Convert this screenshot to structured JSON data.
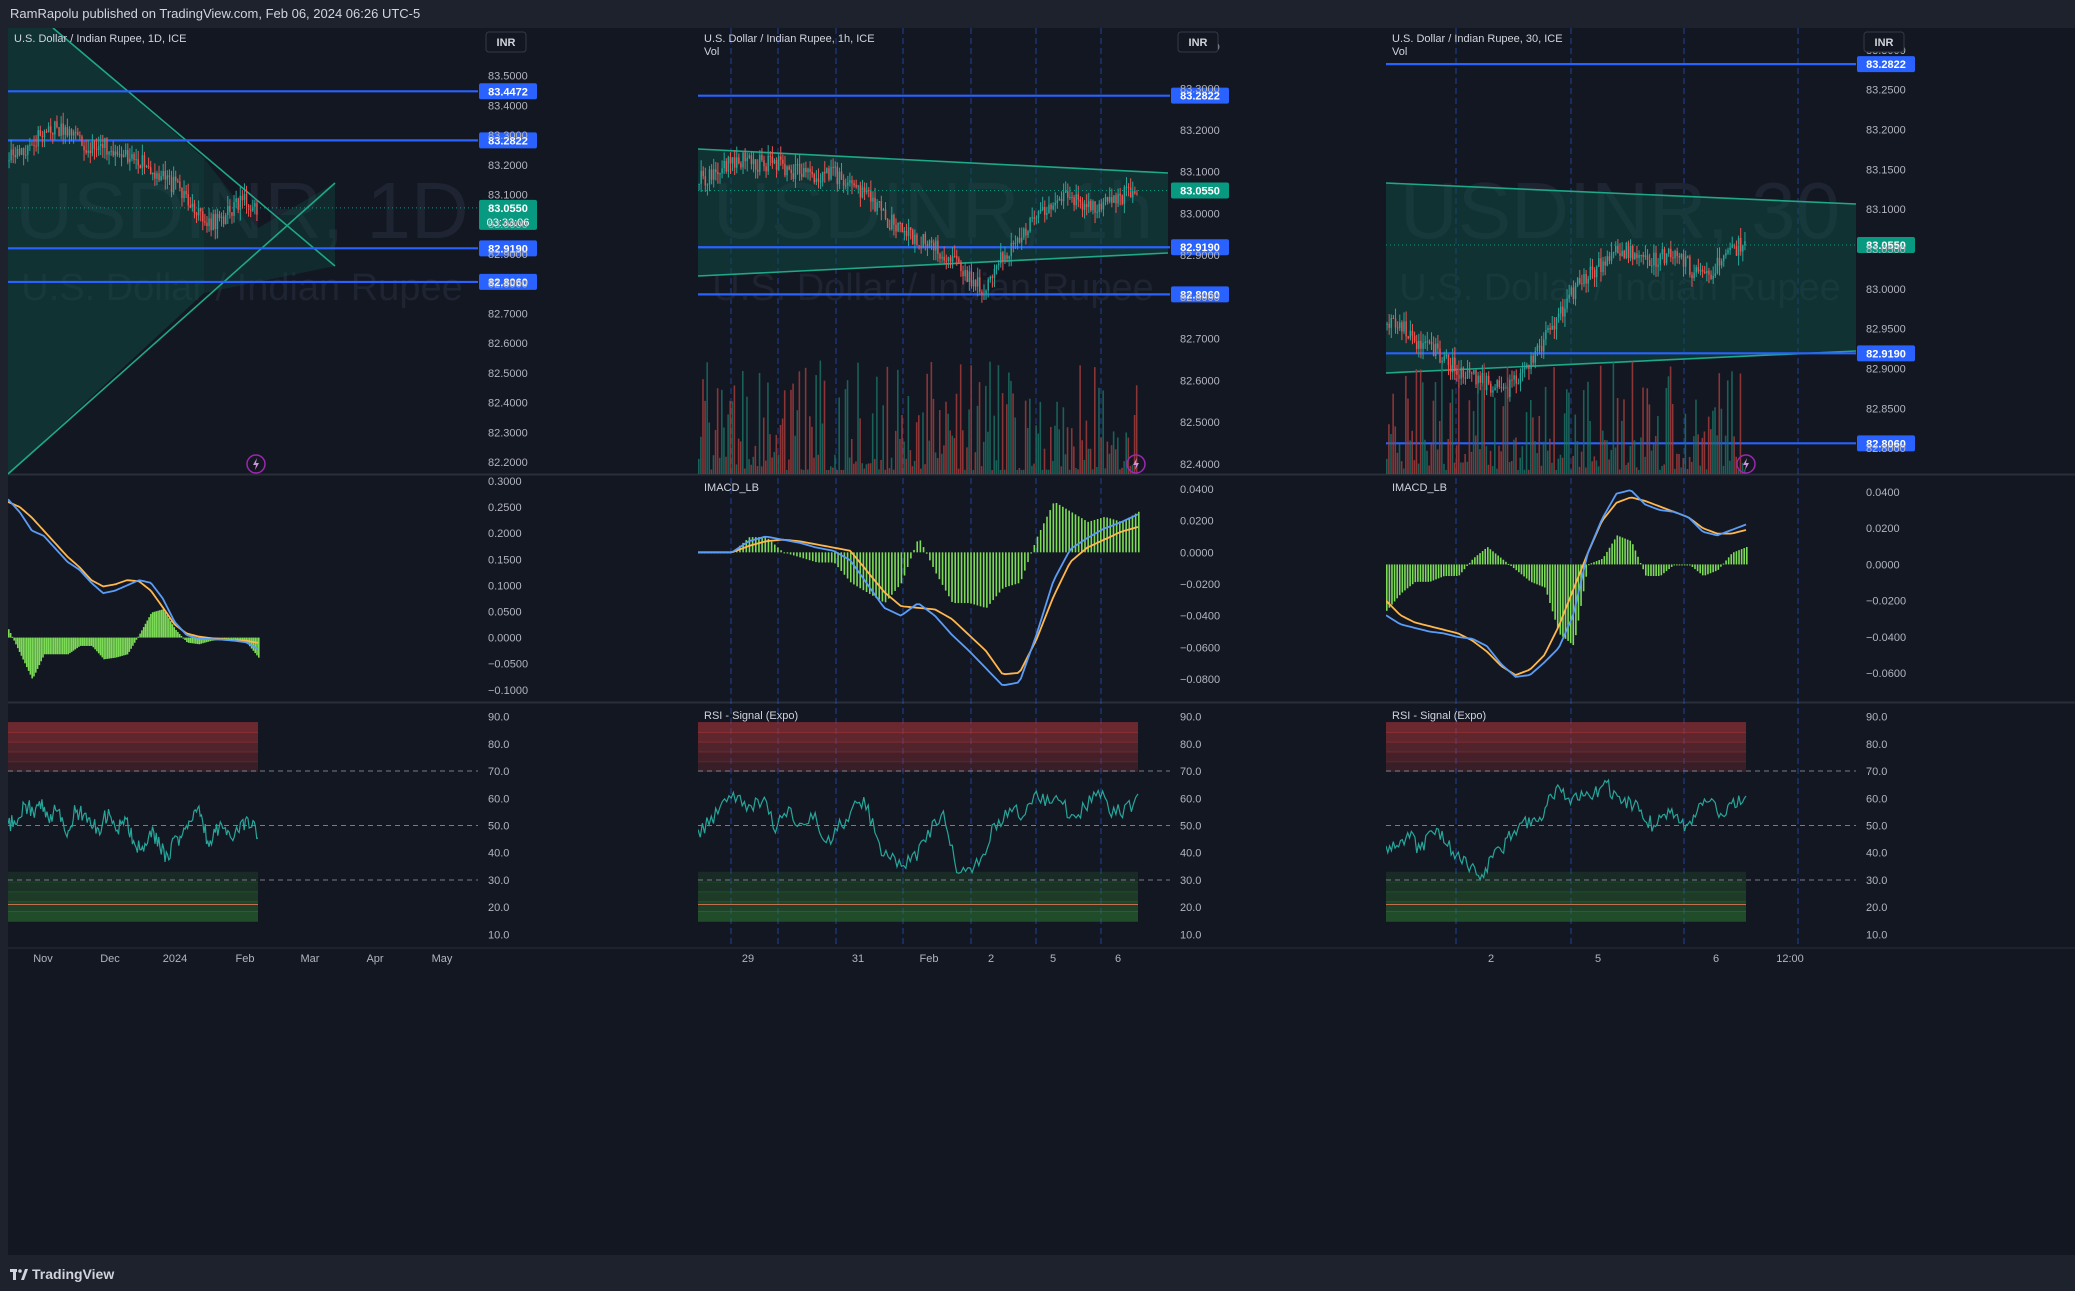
{
  "header": {
    "published_text": "RamRapolu published on TradingView.com, Feb 06, 2024 06:26 UTC-5"
  },
  "footer": {
    "brand": "TradingView"
  },
  "colors": {
    "background": "#131722",
    "grid": "#1e2230",
    "level_line": "#2962ff",
    "label_blue": "#2962ff",
    "last_price": "#089981",
    "triangle": "#1ea888",
    "macd": "#5b9cf6",
    "signal": "#ffb74d",
    "hist_up": "#7ddc57",
    "rsi": "#26a69a",
    "ob_band": "#b5373a",
    "os_band": "#2e7d32"
  },
  "icons": [
    "lightning-icon",
    "tradingview-logo-icon"
  ],
  "chart_data": [
    {
      "type": "candlestick",
      "title": "U.S. Dollar / Indian Rupee, 1D, ICE",
      "watermark_symbol": "USDINR, 1D",
      "watermark_name": "U.S. Dollar / Indian Rupee",
      "currency": "INR",
      "yticks": [
        "83.5000",
        "83.4000",
        "83.3000",
        "83.2000",
        "83.1000",
        "83.0000",
        "82.9000",
        "82.8000",
        "82.7000",
        "82.6000",
        "82.5000",
        "82.4000",
        "82.3000",
        "82.2000"
      ],
      "ylim": [
        82.18,
        83.64
      ],
      "xticks": [
        "Nov",
        "Dec",
        "2024",
        "Feb",
        "Mar",
        "Apr",
        "May"
      ],
      "levels": [
        83.4472,
        83.2822,
        82.919,
        82.806
      ],
      "level_labels": [
        "83.4472",
        "83.2822",
        "82.9190",
        "82.8060"
      ],
      "last_price": "83.0550",
      "countdown": "03:33:06",
      "approx_range": {
        "start_date": "2023-10-20",
        "end_date": "2024-02-06",
        "high": 83.47,
        "low": 82.79,
        "close": 83.055
      },
      "macd": {
        "title": "",
        "yticks": [
          "0.3000",
          "0.2500",
          "0.2000",
          "0.1500",
          "0.1000",
          "0.0500",
          "0.0000",
          "−0.0500",
          "−0.1000"
        ],
        "ylim": [
          -0.11,
          0.3
        ],
        "macd_values": [
          0.265,
          0.24,
          0.205,
          0.195,
          0.17,
          0.145,
          0.13,
          0.105,
          0.085,
          0.09,
          0.1,
          0.11,
          0.105,
          0.075,
          0.03,
          0.005,
          -0.002,
          -0.003,
          -0.004,
          -0.006,
          -0.009,
          -0.022
        ],
        "signal_values": [
          0.26,
          0.25,
          0.23,
          0.205,
          0.18,
          0.155,
          0.135,
          0.11,
          0.098,
          0.102,
          0.11,
          0.108,
          0.09,
          0.058,
          0.025,
          0.008,
          0.002,
          -0.001,
          -0.003,
          -0.005,
          -0.006,
          -0.01
        ]
      },
      "rsi": {
        "title": "",
        "yticks": [
          "90.0",
          "80.0",
          "70.0",
          "60.0",
          "50.0",
          "40.0",
          "30.0",
          "20.0",
          "10.0"
        ],
        "ylim": [
          5,
          95
        ],
        "dashed_levels": [
          70,
          50,
          30
        ],
        "values": [
          50,
          52,
          58,
          55,
          57,
          53,
          56,
          47,
          55,
          54,
          51,
          49,
          55,
          47,
          53,
          45,
          41,
          48,
          45,
          38,
          44,
          47,
          52,
          55,
          44,
          48,
          50,
          45,
          49,
          51,
          47
        ]
      }
    },
    {
      "type": "candlestick",
      "title": "U.S. Dollar / Indian Rupee, 1h, ICE",
      "volume_label": "Vol",
      "watermark_symbol": "USDINR, 1h",
      "watermark_name": "U.S. Dollar / Indian Rupee",
      "currency": "INR",
      "yticks": [
        "83.4000",
        "83.3000",
        "83.2000",
        "83.1000",
        "83.0000",
        "82.9000",
        "82.8000",
        "82.7000",
        "82.6000",
        "82.5000",
        "82.4000"
      ],
      "ylim": [
        82.39,
        83.43
      ],
      "xticks": [
        "29",
        "31",
        "Feb",
        "2",
        "5",
        "6"
      ],
      "levels": [
        83.2822,
        82.919,
        82.806
      ],
      "level_labels": [
        "83.2822",
        "82.9190",
        "82.8060"
      ],
      "last_price": "83.0550",
      "approx_range": {
        "high": 83.15,
        "low": 82.8,
        "close": 83.055
      },
      "macd": {
        "title": "IMACD_LB",
        "yticks": [
          "0.0400",
          "0.0200",
          "0.0000",
          "−0.0200",
          "−0.0400",
          "−0.0600",
          "−0.0800"
        ],
        "ylim": [
          -0.09,
          0.045
        ],
        "macd_values": [
          0,
          0,
          0,
          0.007,
          0.01,
          0.008,
          0.006,
          0.003,
          0.001,
          -0.005,
          -0.02,
          -0.035,
          -0.04,
          -0.032,
          -0.04,
          -0.052,
          -0.062,
          -0.073,
          -0.084,
          -0.082,
          -0.052,
          -0.018,
          0.002,
          0.009,
          0.015,
          0.019,
          0.024
        ],
        "signal_values": [
          0,
          0,
          0,
          0.004,
          0.007,
          0.008,
          0.007,
          0.005,
          0.003,
          0.001,
          -0.012,
          -0.025,
          -0.034,
          -0.035,
          -0.036,
          -0.042,
          -0.052,
          -0.062,
          -0.077,
          -0.076,
          -0.055,
          -0.028,
          -0.006,
          0.003,
          0.008,
          0.013,
          0.016
        ]
      },
      "rsi": {
        "title": "RSI - Signal (Expo)",
        "yticks": [
          "90.0",
          "80.0",
          "70.0",
          "60.0",
          "50.0",
          "40.0",
          "30.0",
          "20.0",
          "10.0"
        ],
        "ylim": [
          5,
          95
        ],
        "dashed_levels": [
          70,
          50,
          30
        ],
        "values": [
          48,
          52,
          58,
          62,
          55,
          60,
          50,
          56,
          48,
          54,
          44,
          50,
          56,
          58,
          42,
          38,
          36,
          40,
          49,
          54,
          35,
          32,
          40,
          50,
          56,
          54,
          61,
          58,
          60,
          52,
          57,
          62,
          54,
          56,
          60
        ]
      }
    },
    {
      "type": "candlestick",
      "title": "U.S. Dollar / Indian Rupee, 30, ICE",
      "volume_label": "Vol",
      "watermark_symbol": "USDINR, 30",
      "watermark_name": "U.S. Dollar / Indian Rupee",
      "currency": "INR",
      "yticks": [
        "83.3000",
        "83.2500",
        "83.2000",
        "83.1500",
        "83.1000",
        "83.0500",
        "83.0000",
        "82.9500",
        "82.9000",
        "82.8500",
        "82.8000"
      ],
      "ylim": [
        82.775,
        83.32
      ],
      "xticks": [
        "2",
        "5",
        "6",
        "12:00"
      ],
      "levels": [
        83.2822,
        82.919,
        82.806
      ],
      "level_labels": [
        "83.2822",
        "82.9190",
        "82.8060"
      ],
      "last_price": "83.0550",
      "approx_range": {
        "high": 83.07,
        "low": 82.86,
        "close": 83.055
      },
      "macd": {
        "title": "IMACD_LB",
        "yticks": [
          "0.0400",
          "0.0200",
          "0.0000",
          "−0.0200",
          "−0.0400",
          "−0.0600"
        ],
        "ylim": [
          -0.072,
          0.046
        ],
        "macd_values": [
          -0.028,
          -0.033,
          -0.035,
          -0.037,
          -0.038,
          -0.04,
          -0.041,
          -0.045,
          -0.055,
          -0.062,
          -0.061,
          -0.054,
          -0.046,
          -0.028,
          0.006,
          0.025,
          0.039,
          0.041,
          0.033,
          0.03,
          0.029,
          0.026,
          0.018,
          0.016,
          0.019,
          0.022
        ],
        "signal_values": [
          -0.02,
          -0.028,
          -0.032,
          -0.034,
          -0.036,
          -0.038,
          -0.042,
          -0.048,
          -0.056,
          -0.061,
          -0.058,
          -0.05,
          -0.034,
          -0.014,
          0.006,
          0.024,
          0.034,
          0.037,
          0.035,
          0.032,
          0.029,
          0.026,
          0.02,
          0.017,
          0.017,
          0.019
        ]
      },
      "rsi": {
        "title": "RSI - Signal (Expo)",
        "yticks": [
          "90.0",
          "80.0",
          "70.0",
          "60.0",
          "50.0",
          "40.0",
          "30.0",
          "20.0",
          "10.0"
        ],
        "ylim": [
          5,
          95
        ],
        "dashed_levels": [
          70,
          50,
          30
        ],
        "values": [
          42,
          45,
          46,
          41,
          47,
          45,
          38,
          36,
          30,
          38,
          42,
          48,
          52,
          50,
          60,
          64,
          60,
          63,
          62,
          65,
          60,
          58,
          55,
          50,
          56,
          52,
          48,
          56,
          60,
          52,
          58,
          62
        ]
      }
    }
  ]
}
